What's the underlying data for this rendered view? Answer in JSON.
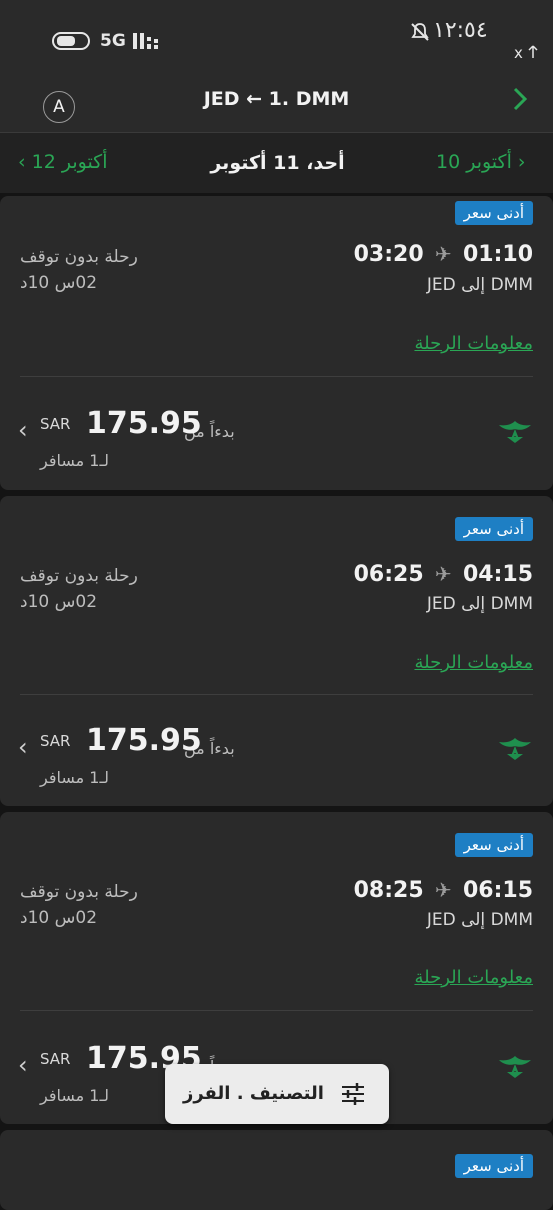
{
  "status": {
    "network": "5G",
    "time": "١٢:٥٤",
    "close_x": "x"
  },
  "header": {
    "avatar_letter": "A",
    "route_title": "JED ← 1. DMM"
  },
  "datebar": {
    "prev_date": "10 أكتوبر",
    "current_date": "أحد، 11 أكتوبر",
    "next_date": "12 أكتوبر"
  },
  "flights": [
    {
      "badge": "أدنى سعر",
      "depart": "01:10",
      "arrive": "03:20",
      "route": "DMM إلى JED",
      "nonstop": "رحلة بدون توقف",
      "duration": "02س 10د",
      "info_link": "معلومات الرحلة",
      "from_label": "بدءاً من",
      "price": "175.95",
      "currency": "SAR",
      "passengers": "لـ1 مسافر"
    },
    {
      "badge": "أدنى سعر",
      "depart": "04:15",
      "arrive": "06:25",
      "route": "DMM إلى JED",
      "nonstop": "رحلة بدون توقف",
      "duration": "02س 10د",
      "info_link": "معلومات الرحلة",
      "from_label": "بدءاً من",
      "price": "175.95",
      "currency": "SAR",
      "passengers": "لـ1 مسافر"
    },
    {
      "badge": "أدنى سعر",
      "depart": "06:15",
      "arrive": "08:25",
      "route": "DMM إلى JED",
      "nonstop": "رحلة بدون توقف",
      "duration": "02س 10د",
      "info_link": "معلومات الرحلة",
      "from_label": "بدءاً من",
      "price": "175.95",
      "currency": "SAR",
      "passengers": "لـ1 مسافر"
    },
    {
      "badge": "أدنى سعر"
    }
  ],
  "sort_filter": {
    "label": "التصنيف . الفرز"
  },
  "colors": {
    "accent_green": "#2aa655",
    "badge_blue": "#1e7fc4",
    "card_bg": "#2a2a2a",
    "page_bg": "#141414"
  },
  "icons": [
    "battery-icon",
    "signal-icon",
    "mute-icon",
    "close-icon",
    "forward-chevron-icon",
    "plane-icon",
    "saudia-logo-icon",
    "chevron-left-icon",
    "filter-sliders-icon"
  ]
}
